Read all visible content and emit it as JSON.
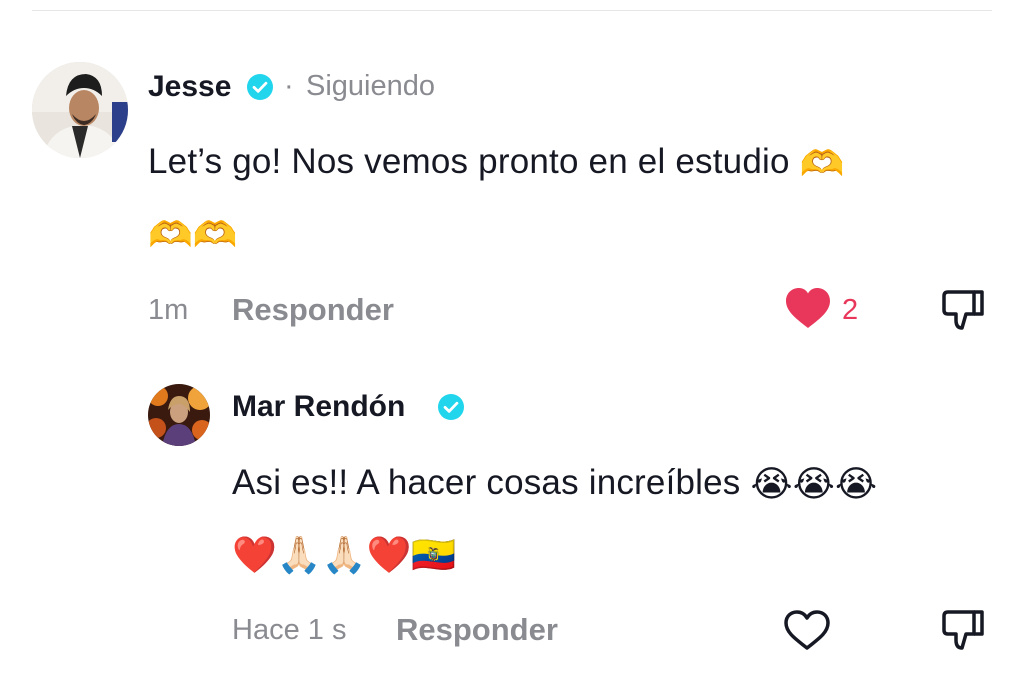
{
  "comments": [
    {
      "author": "Jesse",
      "verified": true,
      "separator": "·",
      "follow_status": "Siguiendo",
      "text": "Let’s go! Nos vemos pronto en el estudio",
      "text_emoji": "🫶",
      "emoji_line": "🫶🫶",
      "time": "1m",
      "reply_label": "Responder",
      "liked": true,
      "like_count": "2"
    },
    {
      "author": "Mar Rendón",
      "verified": true,
      "text": "Asi es!! A hacer cosas increíbles",
      "text_emoji": "😭😭😭",
      "emoji_line": "❤️🙏🏻🙏🏻❤️🇪🇨",
      "time": "Hace 1 s",
      "reply_label": "Responder",
      "liked": false
    }
  ],
  "colors": {
    "like_active": "#e8375a",
    "verified_badge": "#20d5ec",
    "muted_text": "#8a8b91"
  },
  "icons": {
    "like": "heart-icon",
    "dislike": "thumbs-down-icon",
    "verified": "verified-badge-icon"
  }
}
